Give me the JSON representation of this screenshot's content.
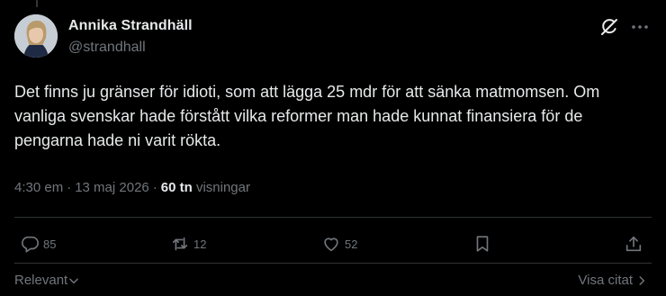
{
  "author": {
    "name": "Annika Strandhäll",
    "handle": "@strandhall"
  },
  "tweet": {
    "text": "Det finns ju gränser för idioti, som att lägga 25 mdr för att sänka matmomsen. Om vanliga svenskar hade förstått vilka reformer man hade kunnat finansiera för de pengarna hade ni varit rökta.",
    "time": "4:30 em",
    "separator": "·",
    "date": "13 maj 2026",
    "views_count": "60 tn",
    "views_label": "visningar"
  },
  "actions": {
    "replies": "85",
    "reposts": "12",
    "likes": "52"
  },
  "footer": {
    "sort_label": "Relevant",
    "quotes_label": "Visa citat"
  },
  "icons": [
    "grok-icon",
    "more-icon",
    "reply-icon",
    "repost-icon",
    "like-icon",
    "bookmark-icon",
    "share-icon",
    "chevron-down-icon",
    "chevron-right-icon"
  ],
  "colors": {
    "background": "#000000",
    "text": "#e7e9ea",
    "muted": "#71767b",
    "divider": "#2f3336"
  }
}
